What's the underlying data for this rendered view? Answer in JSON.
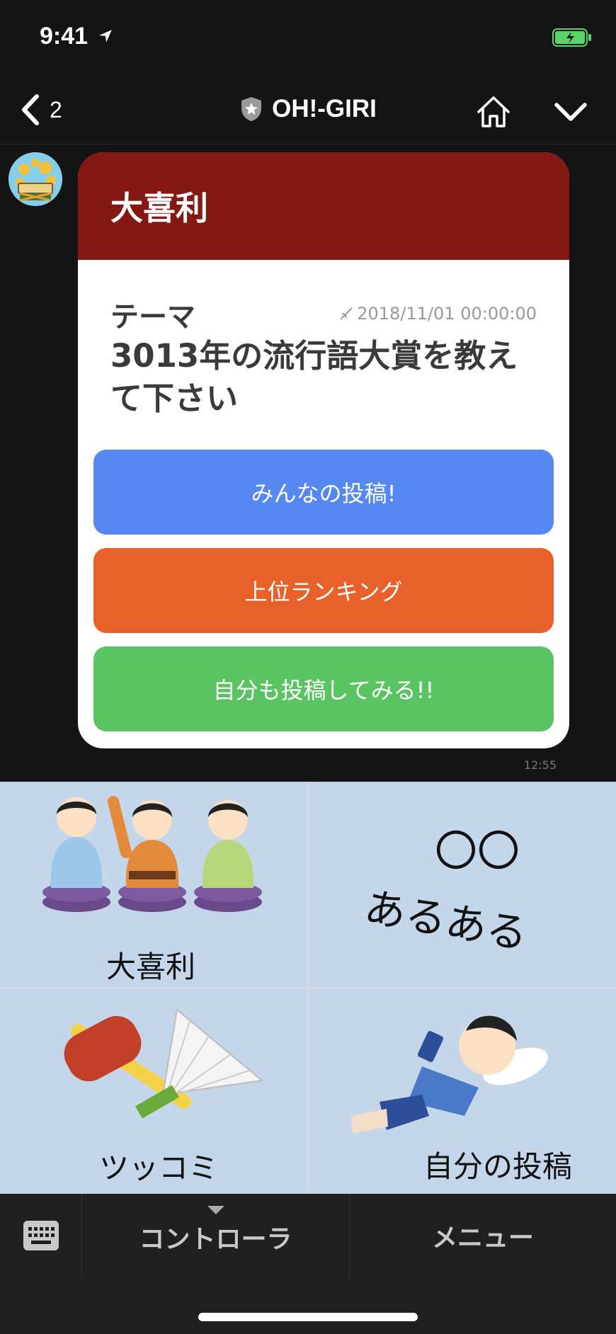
{
  "status_bar": {
    "time": "9:41"
  },
  "header": {
    "back_count": "2",
    "title": "OH!-GIRI"
  },
  "card": {
    "heading": "大喜利",
    "theme_label": "テーマ",
    "deadline": "2018/11/01 00:00:00",
    "question": "3013年の流行語大賞を教えて下さい",
    "buttons": [
      {
        "label": "みんなの投稿!",
        "color": "#5588f0"
      },
      {
        "label": "上位ランキング",
        "color": "#e8612b"
      },
      {
        "label": "自分も投稿してみる!!",
        "color": "#5bc462"
      }
    ]
  },
  "message_time": "12:55",
  "rich_menu": {
    "items": [
      {
        "label": "大喜利"
      },
      {
        "label_line1": "〇〇",
        "label_line2": "あるある"
      },
      {
        "label": "ツッコミ"
      },
      {
        "label": "自分の投稿"
      }
    ],
    "background_color": "#c4d6ea"
  },
  "bottom_bar": {
    "controller_label": "コントローラ",
    "menu_label": "メニュー"
  },
  "colors": {
    "card_header": "#841812",
    "battery": "#5bd36b"
  }
}
